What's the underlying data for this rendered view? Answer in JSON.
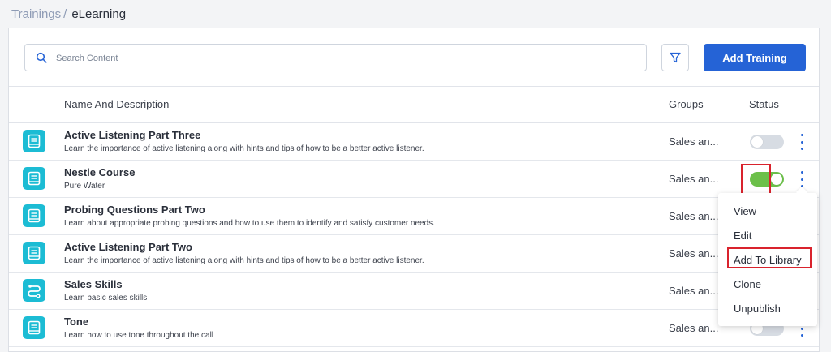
{
  "breadcrumb": {
    "parent": "Trainings",
    "separator": "/",
    "current": "eLearning"
  },
  "search": {
    "placeholder": "Search Content",
    "value": ""
  },
  "toolbar": {
    "add_label": "Add Training"
  },
  "table": {
    "headers": {
      "name": "Name And Description",
      "groups": "Groups",
      "status": "Status"
    },
    "rows": [
      {
        "title": "Active Listening Part Three",
        "desc": "Learn the importance of active listening along with hints and tips of how to be a better active listener.",
        "groups": "Sales an...",
        "status_on": false,
        "icon": "book-icon"
      },
      {
        "title": "Nestle Course",
        "desc": "Pure Water",
        "groups": "Sales an...",
        "status_on": true,
        "icon": "book-icon"
      },
      {
        "title": "Probing Questions Part Two",
        "desc": "Learn about appropriate probing questions and how to use them to identify and satisfy customer needs.",
        "groups": "Sales an...",
        "status_on": null,
        "icon": "book-icon"
      },
      {
        "title": "Active Listening Part Two",
        "desc": "Learn the importance of active listening along with hints and tips of how to be a better active listener.",
        "groups": "Sales an...",
        "status_on": null,
        "icon": "book-icon"
      },
      {
        "title": "Sales Skills",
        "desc": "Learn basic sales skills",
        "groups": "Sales an...",
        "status_on": null,
        "icon": "path-icon"
      },
      {
        "title": "Tone",
        "desc": "Learn how to use tone throughout the call",
        "groups": "Sales an...",
        "status_on": false,
        "icon": "book-icon"
      }
    ]
  },
  "context_menu": {
    "items": [
      "View",
      "Edit",
      "Add To Library",
      "Clone",
      "Unpublish"
    ],
    "highlighted": "Add To Library"
  },
  "colors": {
    "accent": "#2563d6",
    "icon_tile": "#1cbcd4",
    "toggle_on": "#6cc04a",
    "highlight": "#d9232d"
  }
}
